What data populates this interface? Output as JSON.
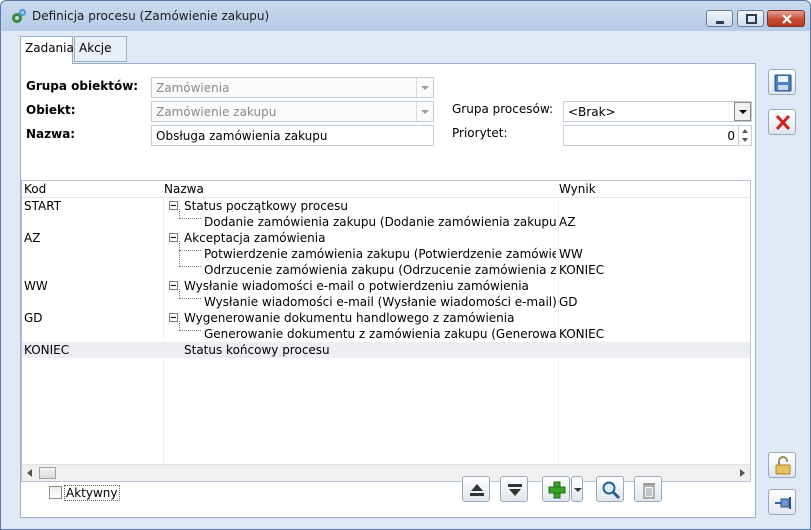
{
  "window": {
    "title": "Definicja procesu (Zamówienie zakupu)"
  },
  "tabs": [
    {
      "label": "Zadania",
      "active": true
    },
    {
      "label": "Akcje",
      "active": false
    }
  ],
  "form": {
    "grupa_obiektow_label": "Grupa obiektów:",
    "grupa_obiektow_value": "Zamówienia",
    "obiekt_label": "Obiekt:",
    "obiekt_value": "Zamówienie zakupu",
    "nazwa_label": "Nazwa:",
    "nazwa_value": "Obsługa zamówienia zakupu",
    "grupa_procesow_label": "Grupa procesów:",
    "grupa_procesow_value": "<Brak>",
    "priorytet_label": "Priorytet:",
    "priorytet_value": "0"
  },
  "grid": {
    "columns": {
      "kod": "Kod",
      "nazwa": "Nazwa",
      "wynik": "Wynik"
    },
    "rows": [
      {
        "kod": "START",
        "nazwa": "Status początkowy procesu",
        "wynik": ""
      },
      {
        "kod": "",
        "nazwa": "Dodanie zamówienia zakupu (Dodanie zamówienia zakupu)",
        "wynik": "AZ"
      },
      {
        "kod": "AZ",
        "nazwa": "Akceptacja zamówienia",
        "wynik": ""
      },
      {
        "kod": "",
        "nazwa": "Potwierdzenie zamówienia zakupu (Potwierdzenie zamówienia",
        "wynik": "WW"
      },
      {
        "kod": "",
        "nazwa": "Odrzucenie zamówienia zakupu (Odrzucenie zamówienia zaku",
        "wynik": "KONIEC"
      },
      {
        "kod": "WW",
        "nazwa": "Wysłanie wiadomości e-mail o potwierdzeniu zamówienia",
        "wynik": ""
      },
      {
        "kod": "",
        "nazwa": "Wysłanie wiadomości e-mail (Wysłanie wiadomości e-mail)",
        "wynik": "GD"
      },
      {
        "kod": "GD",
        "nazwa": "Wygenerowanie dokumentu handlowego z zamówienia",
        "wynik": ""
      },
      {
        "kod": "",
        "nazwa": "Generowanie dokumentu z zamówienia zakupu (Generowanie",
        "wynik": "KONIEC"
      },
      {
        "kod": "KONIEC",
        "nazwa": "Status końcowy procesu",
        "wynik": ""
      }
    ]
  },
  "aktywny_label": "Aktywny",
  "colors": {
    "accent": "#4a7fc1",
    "close_button": "#c74a32",
    "add_green": "#3aa12b"
  }
}
